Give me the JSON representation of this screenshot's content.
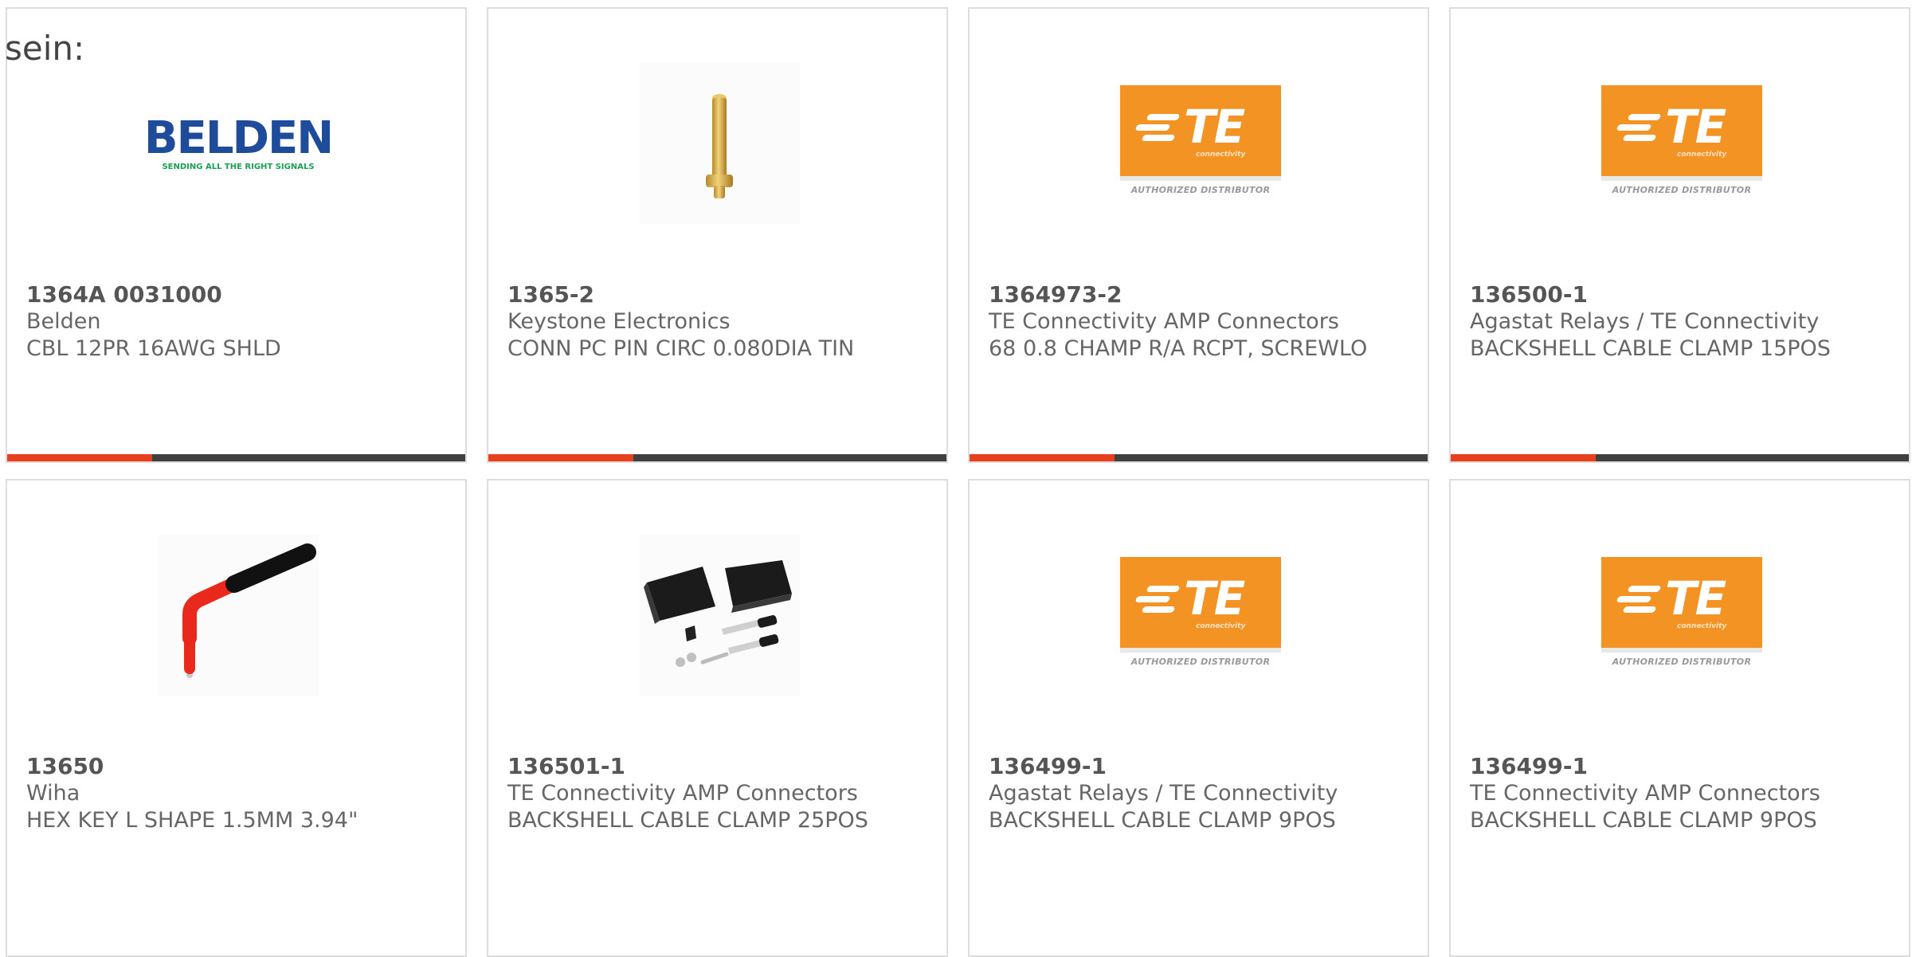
{
  "page": {
    "intro_text": "sein:"
  },
  "colors": {
    "accent_red": "#e8401c",
    "bar_dark": "#404040",
    "te_orange": "#f39324",
    "belden_blue": "#1e4b9a",
    "belden_green": "#1a9e55",
    "card_border": "#dddddd"
  },
  "products": [
    {
      "part_number": "1364A 0031000",
      "manufacturer": "Belden",
      "description": "CBL 12PR 16AWG SHLD",
      "image": "belden-logo"
    },
    {
      "part_number": "1365-2",
      "manufacturer": "Keystone Electronics",
      "description": "CONN PC PIN CIRC 0.080DIA TIN",
      "image": "pc-pin-photo"
    },
    {
      "part_number": "1364973-2",
      "manufacturer": "TE Connectivity AMP Connectors",
      "description": "68 0.8 CHAMP R/A RCPT, SCREWLO",
      "image": "te-logo"
    },
    {
      "part_number": "136500-1",
      "manufacturer": "Agastat Relays / TE Connectivity",
      "description": "BACKSHELL CABLE CLAMP 15POS",
      "image": "te-logo"
    },
    {
      "part_number": "13650",
      "manufacturer": "Wiha",
      "description": "HEX KEY L SHAPE 1.5MM 3.94\"",
      "image": "hex-key-photo"
    },
    {
      "part_number": "136501-1",
      "manufacturer": "TE Connectivity AMP Connectors",
      "description": "BACKSHELL CABLE CLAMP 25POS",
      "image": "backshell-photo"
    },
    {
      "part_number": "136499-1",
      "manufacturer": "Agastat Relays / TE Connectivity",
      "description": "BACKSHELL CABLE CLAMP 9POS",
      "image": "te-logo"
    },
    {
      "part_number": "136499-1",
      "manufacturer": "TE Connectivity AMP Connectors",
      "description": "BACKSHELL CABLE CLAMP 9POS",
      "image": "te-logo"
    }
  ],
  "logos": {
    "belden_word": "BELDEN",
    "belden_tagline": "SENDING ALL THE RIGHT SIGNALS",
    "te_word": "TE",
    "te_sub": "connectivity",
    "te_authorized": "AUTHORIZED DISTRIBUTOR"
  }
}
